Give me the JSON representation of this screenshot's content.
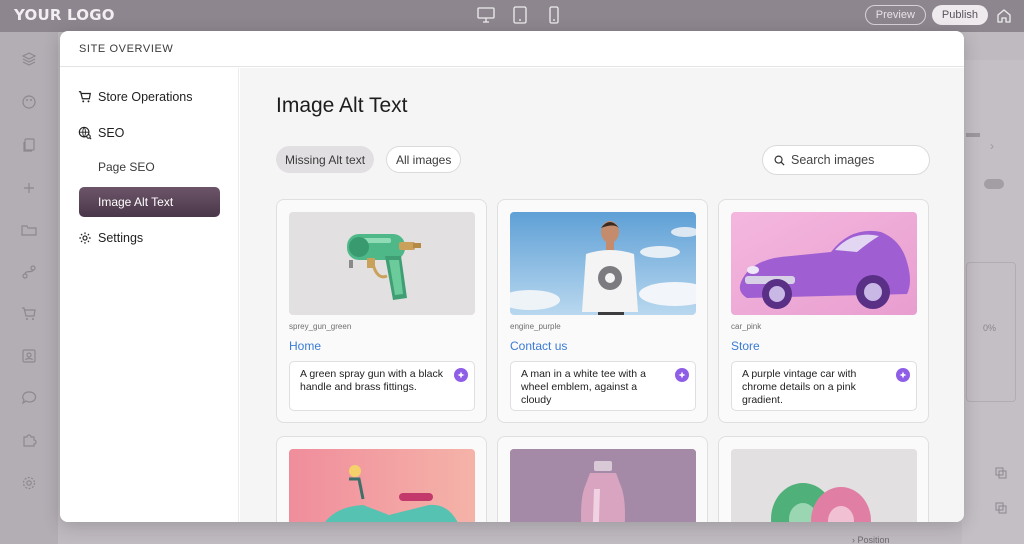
{
  "app": {
    "logo": "YOUR LOGO",
    "preview_label": "Preview",
    "publish_label": "Publish"
  },
  "background": {
    "position_label": "Position",
    "percent_label": "0%"
  },
  "modal": {
    "title": "SITE OVERVIEW",
    "nav": {
      "store_operations": "Store Operations",
      "seo": "SEO",
      "page_seo": "Page SEO",
      "image_alt_text": "Image Alt Text",
      "settings": "Settings"
    },
    "main": {
      "title": "Image Alt Text",
      "filters": {
        "missing": "Missing Alt text",
        "all": "All images"
      },
      "search_placeholder": "Search images",
      "cards": [
        {
          "file": "sprey_gun_green",
          "page": "Home",
          "alt": "A green spray gun with a black handle and brass fittings."
        },
        {
          "file": "engine_purple",
          "page": "Contact us",
          "alt": "A man in a white tee with a wheel emblem, against a cloudy"
        },
        {
          "file": "car_pink",
          "page": "Store",
          "alt": "A purple vintage car with chrome details on a pink gradient."
        }
      ]
    }
  },
  "colors": {
    "accent": "#8f5ee6",
    "link": "#3a7bd5",
    "active_nav": "#5a4358"
  }
}
